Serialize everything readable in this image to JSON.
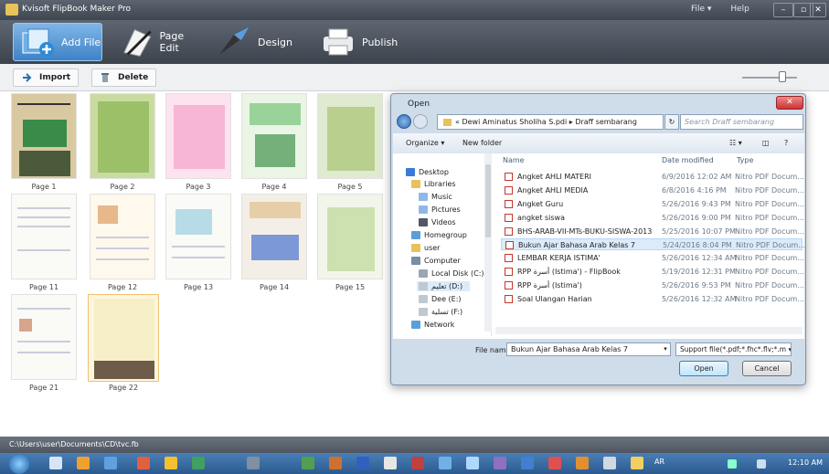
{
  "window": {
    "title": "Kvisoft FlipBook Maker Pro",
    "menu": [
      "File ▾",
      "Help"
    ],
    "controls": [
      "–",
      "▫",
      "✕"
    ]
  },
  "toolbar": {
    "items": [
      {
        "label": "Add File",
        "icon": "add-file-icon",
        "active": true
      },
      {
        "label": "Page Edit",
        "icon": "page-edit-icon"
      },
      {
        "label": "Design",
        "icon": "design-icon"
      },
      {
        "label": "Publish",
        "icon": "publish-icon"
      }
    ]
  },
  "subbar": {
    "import": "Import",
    "delete": "Delete"
  },
  "pages": [
    "Page 1",
    "Page 2",
    "Page 3",
    "Page 4",
    "Page 5",
    "Page 11",
    "Page 12",
    "Page 13",
    "Page 14",
    "Page 15",
    "Page 21",
    "Page 22"
  ],
  "status": "C:\\Users\\user\\Documents\\CD\\tvc.fb",
  "dialog": {
    "title": "Open",
    "address": "« Dewi Aminatus Sholiha S.pdi  ▸  Draff sembarang",
    "search_placeholder": "Search Draff sembarang",
    "organize": "Organize ▾",
    "new_folder": "New folder",
    "columns": {
      "name": "Name",
      "date": "Date modified",
      "type": "Type"
    },
    "nav": [
      "Desktop",
      "Libraries",
      "Music",
      "Pictures",
      "Videos",
      "Homegroup",
      "user",
      "Computer",
      "Local Disk (C:)",
      "تعليم (D:)",
      "Dee (E:)",
      "تسلية (F:)",
      "Network"
    ],
    "files": [
      {
        "name": "Angket AHLI MATERI",
        "date": "6/9/2016 12:02 AM",
        "type": "Nitro PDF Docum..."
      },
      {
        "name": "Angket AHLI MEDIA",
        "date": "6/8/2016 4:16 PM",
        "type": "Nitro PDF Docum..."
      },
      {
        "name": "Angket Guru",
        "date": "5/26/2016 9:43 PM",
        "type": "Nitro PDF Docum..."
      },
      {
        "name": "angket siswa",
        "date": "5/26/2016 9:00 PM",
        "type": "Nitro PDF Docum..."
      },
      {
        "name": "BHS-ARAB-VII-MTs-BUKU-SISWA-2013",
        "date": "5/25/2016 10:07 PM",
        "type": "Nitro PDF Docum..."
      },
      {
        "name": "Bukun Ajar Bahasa Arab Kelas 7",
        "date": "5/24/2016 8:04 PM",
        "type": "Nitro PDF Docum..."
      },
      {
        "name": "LEMBAR KERJA ISTIMA'",
        "date": "5/26/2016 12:34 AM",
        "type": "Nitro PDF Docum..."
      },
      {
        "name": "RPP  أسرة (Istima') - FlipBook",
        "date": "5/19/2016 12:31 PM",
        "type": "Nitro PDF Docum..."
      },
      {
        "name": "RPP  أسرة (Istima')",
        "date": "5/26/2016 9:53 PM",
        "type": "Nitro PDF Docum..."
      },
      {
        "name": "Soal Ulangan Harian",
        "date": "5/26/2016 12:32 AM",
        "type": "Nitro PDF Docum..."
      }
    ],
    "filename_label": "File name:",
    "filename": "Bukun Ajar Bahasa Arab Kelas 7",
    "filetype": "Support file(*.pdf;*.fhc*.flv;*.m ▾",
    "open": "Open",
    "cancel": "Cancel"
  },
  "taskbar": {
    "tray": "AR",
    "clock": "12:10 AM"
  }
}
